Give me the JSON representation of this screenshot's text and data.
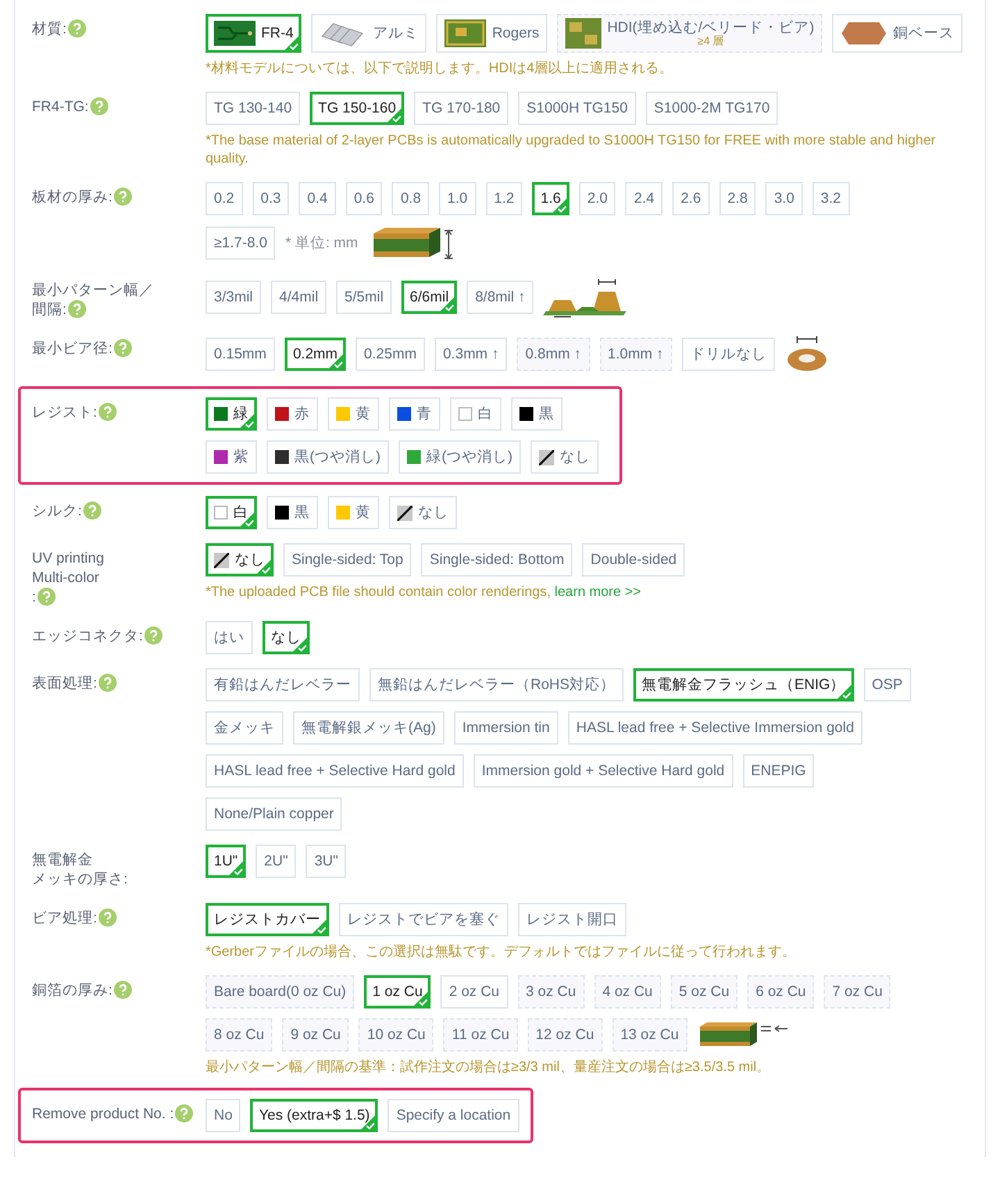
{
  "rows": [
    {
      "kind": "material",
      "label": "材質:",
      "help": true,
      "highlighted": false,
      "options": [
        {
          "kind": "material",
          "label": "FR-4",
          "selected": true,
          "disabled": false
        },
        {
          "kind": "material",
          "label": "アルミ",
          "selected": false,
          "disabled": false
        },
        {
          "kind": "material",
          "label": "Rogers",
          "selected": false,
          "disabled": false
        },
        {
          "kind": "material",
          "label": "HDI(埋め込む/ベリード・ビア)",
          "sublabel": "≥4 層",
          "selected": false,
          "disabled": true
        },
        {
          "kind": "material",
          "label": "銅ベース",
          "selected": false,
          "disabled": false
        }
      ],
      "notes": [
        {
          "text": "*材料モデルについては、以下で説明します。HDIは4層以上に適用される。"
        }
      ]
    },
    {
      "kind": "plain",
      "label": "FR4-TG:",
      "help": true,
      "highlighted": false,
      "options": [
        {
          "kind": "text",
          "label": "TG 130-140",
          "selected": false,
          "disabled": false
        },
        {
          "kind": "text",
          "label": "TG 150-160",
          "selected": true,
          "disabled": false
        },
        {
          "kind": "text",
          "label": "TG 170-180",
          "selected": false,
          "disabled": false
        },
        {
          "kind": "text",
          "label": "S1000H TG150",
          "selected": false,
          "disabled": false
        },
        {
          "kind": "text",
          "label": "S1000-2M TG170",
          "selected": false,
          "disabled": false
        }
      ],
      "notes": [
        {
          "text": "*The base material of 2-layer PCBs is automatically upgraded to S1000H TG150 for FREE with more stable and higher quality."
        }
      ]
    },
    {
      "kind": "thickness",
      "label": "板材の厚み:",
      "help": true,
      "highlighted": false,
      "unit": "* 単位: mm",
      "options": [
        {
          "kind": "text",
          "label": "0.2",
          "selected": false,
          "disabled": false
        },
        {
          "kind": "text",
          "label": "0.3",
          "selected": false,
          "disabled": false
        },
        {
          "kind": "text",
          "label": "0.4",
          "selected": false,
          "disabled": false
        },
        {
          "kind": "text",
          "label": "0.6",
          "selected": false,
          "disabled": false
        },
        {
          "kind": "text",
          "label": "0.8",
          "selected": false,
          "disabled": false
        },
        {
          "kind": "text",
          "label": "1.0",
          "selected": false,
          "disabled": false
        },
        {
          "kind": "text",
          "label": "1.2",
          "selected": false,
          "disabled": false
        },
        {
          "kind": "text",
          "label": "1.6",
          "selected": true,
          "disabled": false
        },
        {
          "kind": "text",
          "label": "2.0",
          "selected": false,
          "disabled": false
        },
        {
          "kind": "text",
          "label": "2.4",
          "selected": false,
          "disabled": false
        },
        {
          "kind": "text",
          "label": "2.6",
          "selected": false,
          "disabled": false
        },
        {
          "kind": "text",
          "label": "2.8",
          "selected": false,
          "disabled": false
        },
        {
          "kind": "text",
          "label": "3.0",
          "selected": false,
          "disabled": false
        },
        {
          "kind": "text",
          "label": "3.2",
          "selected": false,
          "disabled": false
        },
        {
          "kind": "text",
          "label": "≥1.7-8.0",
          "selected": false,
          "disabled": false
        }
      ]
    },
    {
      "kind": "trace",
      "label": [
        "最小パターン幅／",
        "間隔:"
      ],
      "help": true,
      "highlighted": false,
      "options": [
        {
          "kind": "text",
          "label": "3/3mil",
          "selected": false,
          "disabled": false
        },
        {
          "kind": "text",
          "label": "4/4mil",
          "selected": false,
          "disabled": false
        },
        {
          "kind": "text",
          "label": "5/5mil",
          "selected": false,
          "disabled": false
        },
        {
          "kind": "text",
          "label": "6/6mil",
          "selected": true,
          "disabled": false
        },
        {
          "kind": "text",
          "label": "8/8mil ↑",
          "selected": false,
          "disabled": false
        }
      ]
    },
    {
      "kind": "via",
      "label": "最小ビア径:",
      "help": true,
      "highlighted": false,
      "options": [
        {
          "kind": "text",
          "label": "0.15mm",
          "selected": false,
          "disabled": false
        },
        {
          "kind": "text",
          "label": "0.2mm",
          "selected": true,
          "disabled": false
        },
        {
          "kind": "text",
          "label": "0.25mm",
          "selected": false,
          "disabled": false
        },
        {
          "kind": "text",
          "label": "0.3mm ↑",
          "selected": false,
          "disabled": false
        },
        {
          "kind": "text",
          "label": "0.8mm ↑",
          "selected": false,
          "disabled": true
        },
        {
          "kind": "text",
          "label": "1.0mm ↑",
          "selected": false,
          "disabled": true
        },
        {
          "kind": "text",
          "label": "ドリルなし",
          "selected": false,
          "disabled": false
        }
      ]
    },
    {
      "kind": "plain",
      "label": "レジスト:",
      "help": true,
      "highlighted": true,
      "options": [
        {
          "kind": "swatch",
          "label": "緑",
          "color": "#0b7a1c",
          "selected": true,
          "disabled": false
        },
        {
          "kind": "swatch",
          "label": "赤",
          "color": "#c01418",
          "selected": false,
          "disabled": false
        },
        {
          "kind": "swatch",
          "label": "黄",
          "color": "#ffc800",
          "selected": false,
          "disabled": false
        },
        {
          "kind": "swatch",
          "label": "青",
          "color": "#0a4fe0",
          "selected": false,
          "disabled": false
        },
        {
          "kind": "swatch",
          "label": "白",
          "color": "#ffffff",
          "selected": false,
          "disabled": false
        },
        {
          "kind": "swatch",
          "label": "黒",
          "color": "#000000",
          "selected": false,
          "disabled": false
        },
        {
          "kind": "swatch",
          "label": "紫",
          "color": "#b02ab0",
          "selected": false,
          "disabled": false
        },
        {
          "kind": "swatch",
          "label": "黒(つや消し)",
          "color": "#2e2e2e",
          "selected": false,
          "disabled": false
        },
        {
          "kind": "swatch",
          "label": "緑(つや消し)",
          "color": "#2fa83c",
          "selected": false,
          "disabled": false
        },
        {
          "kind": "none",
          "label": "なし",
          "selected": false,
          "disabled": false
        }
      ]
    },
    {
      "kind": "plain",
      "label": "シルク:",
      "help": true,
      "highlighted": false,
      "options": [
        {
          "kind": "swatch",
          "label": "白",
          "color": "#ffffff",
          "selected": true,
          "disabled": false
        },
        {
          "kind": "swatch",
          "label": "黒",
          "color": "#000000",
          "selected": false,
          "disabled": false
        },
        {
          "kind": "swatch",
          "label": "黄",
          "color": "#ffc800",
          "selected": false,
          "disabled": false
        },
        {
          "kind": "none",
          "label": "なし",
          "selected": false,
          "disabled": false
        }
      ]
    },
    {
      "kind": "plain",
      "label": [
        "UV printing",
        "Multi-color",
        ":"
      ],
      "help": true,
      "highlighted": false,
      "options": [
        {
          "kind": "none",
          "label": "なし",
          "selected": true,
          "disabled": false
        },
        {
          "kind": "text",
          "label": "Single-sided: Top",
          "selected": false,
          "disabled": false
        },
        {
          "kind": "text",
          "label": "Single-sided: Bottom",
          "selected": false,
          "disabled": false
        },
        {
          "kind": "text",
          "label": "Double-sided",
          "selected": false,
          "disabled": false
        }
      ],
      "notes": [
        {
          "text": "*The uploaded PCB file should contain color renderings, ",
          "link": "learn more >>"
        }
      ]
    },
    {
      "kind": "plain",
      "label": "エッジコネクタ:",
      "help": true,
      "highlighted": false,
      "options": [
        {
          "kind": "text",
          "label": "はい",
          "selected": false,
          "disabled": false
        },
        {
          "kind": "text",
          "label": "なし",
          "selected": true,
          "disabled": false
        }
      ]
    },
    {
      "kind": "plain",
      "label": "表面処理:",
      "help": true,
      "highlighted": false,
      "options": [
        {
          "kind": "text",
          "label": "有鉛はんだレベラー",
          "selected": false,
          "disabled": false
        },
        {
          "kind": "text",
          "label": "無鉛はんだレベラー（RoHS対応）",
          "selected": false,
          "disabled": false
        },
        {
          "kind": "text",
          "label": "無電解金フラッシュ（ENIG）",
          "selected": true,
          "disabled": false
        },
        {
          "kind": "text",
          "label": "OSP",
          "selected": false,
          "disabled": false
        },
        {
          "kind": "text",
          "label": "金メッキ",
          "selected": false,
          "disabled": false
        },
        {
          "kind": "text",
          "label": "無電解銀メッキ(Ag)",
          "selected": false,
          "disabled": false
        },
        {
          "kind": "text",
          "label": "Immersion tin",
          "selected": false,
          "disabled": false
        },
        {
          "kind": "text",
          "label": "HASL lead free + Selective Immersion gold",
          "selected": false,
          "disabled": false
        },
        {
          "kind": "text",
          "label": "HASL lead free + Selective Hard gold",
          "selected": false,
          "disabled": false
        },
        {
          "kind": "text",
          "label": "Immersion gold + Selective Hard gold",
          "selected": false,
          "disabled": false
        },
        {
          "kind": "text",
          "label": "ENEPIG",
          "selected": false,
          "disabled": false
        },
        {
          "kind": "text",
          "label": "None/Plain copper",
          "selected": false,
          "disabled": false
        }
      ]
    },
    {
      "kind": "plain",
      "label": [
        "無電解金",
        "メッキの厚さ:"
      ],
      "help": false,
      "highlighted": false,
      "options": [
        {
          "kind": "text",
          "label": "1U\"",
          "selected": true,
          "disabled": false
        },
        {
          "kind": "text",
          "label": "2U\"",
          "selected": false,
          "disabled": false
        },
        {
          "kind": "text",
          "label": "3U\"",
          "selected": false,
          "disabled": false
        }
      ]
    },
    {
      "kind": "plain",
      "label": "ビア処理:",
      "help": true,
      "highlighted": false,
      "options": [
        {
          "kind": "text",
          "label": "レジストカバー",
          "selected": true,
          "disabled": false
        },
        {
          "kind": "text",
          "label": "レジストでビアを塞ぐ",
          "selected": false,
          "disabled": false
        },
        {
          "kind": "text",
          "label": "レジスト開口",
          "selected": false,
          "disabled": false
        }
      ],
      "notes": [
        {
          "text": "*Gerberファイルの場合、この選択は無駄です。デフォルトではファイルに従って行われます。"
        }
      ]
    },
    {
      "kind": "copper",
      "label": "銅箔の厚み:",
      "help": true,
      "highlighted": false,
      "options": [
        {
          "kind": "text",
          "label": "Bare board(0 oz Cu)",
          "selected": false,
          "disabled": true
        },
        {
          "kind": "text",
          "label": "1 oz Cu",
          "selected": true,
          "disabled": false
        },
        {
          "kind": "text",
          "label": "2 oz Cu",
          "selected": false,
          "disabled": false
        },
        {
          "kind": "text",
          "label": "3 oz Cu",
          "selected": false,
          "disabled": true
        },
        {
          "kind": "text",
          "label": "4 oz Cu",
          "selected": false,
          "disabled": true
        },
        {
          "kind": "text",
          "label": "5 oz Cu",
          "selected": false,
          "disabled": true
        },
        {
          "kind": "text",
          "label": "6 oz Cu",
          "selected": false,
          "disabled": true
        },
        {
          "kind": "text",
          "label": "7 oz Cu",
          "selected": false,
          "disabled": true
        },
        {
          "kind": "text",
          "label": "8 oz Cu",
          "selected": false,
          "disabled": true
        },
        {
          "kind": "text",
          "label": "9 oz Cu",
          "selected": false,
          "disabled": true
        },
        {
          "kind": "text",
          "label": "10 oz Cu",
          "selected": false,
          "disabled": true
        },
        {
          "kind": "text",
          "label": "11 oz Cu",
          "selected": false,
          "disabled": true
        },
        {
          "kind": "text",
          "label": "12 oz Cu",
          "selected": false,
          "disabled": true
        },
        {
          "kind": "text",
          "label": "13 oz Cu",
          "selected": false,
          "disabled": true
        }
      ],
      "notes": [
        {
          "text": "最小パターン幅／間隔の基準：試作注文の場合は≥3/3 mil、量産注文の場合は≥3.5/3.5 mil。"
        }
      ]
    },
    {
      "kind": "plain",
      "label": "Remove product No. :",
      "help": true,
      "highlighted": true,
      "options": [
        {
          "kind": "text",
          "label": "No",
          "selected": false,
          "disabled": false
        },
        {
          "kind": "text",
          "label": "Yes (extra+$ 1.5)",
          "selected": true,
          "disabled": false
        },
        {
          "kind": "text",
          "label": "Specify a location",
          "selected": false,
          "disabled": false
        }
      ]
    }
  ]
}
